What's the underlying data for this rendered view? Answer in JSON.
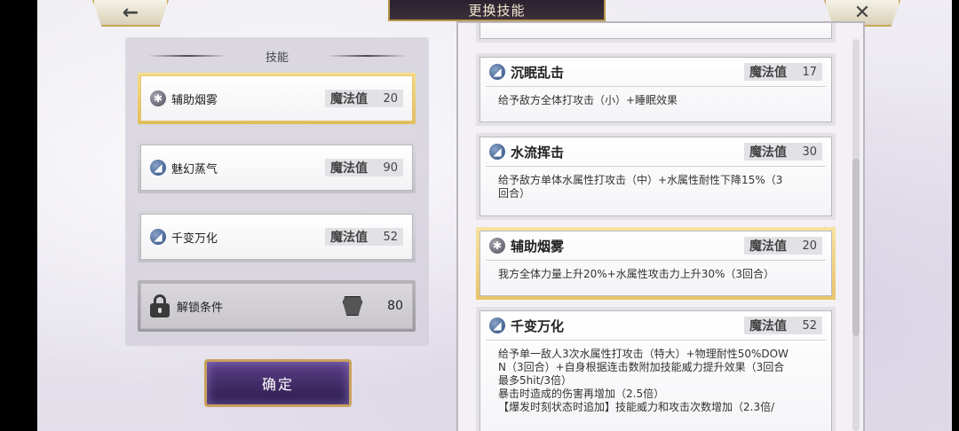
{
  "header": {
    "title": "更换技能",
    "back_icon": "←",
    "close_icon": "✕"
  },
  "left_panel": {
    "title": "技能",
    "slots": [
      {
        "name": "辅助烟雾",
        "mp_label": "魔法值",
        "mp": "20",
        "icon": "support-icon"
      },
      {
        "name": "魅幻蒸气",
        "mp_label": "魔法值",
        "mp": "90",
        "icon": "water-icon"
      },
      {
        "name": "千变万化",
        "mp_label": "魔法值",
        "mp": "52",
        "icon": "water-icon"
      }
    ],
    "locked": {
      "label": "解锁条件",
      "value": "80"
    },
    "confirm_label": "确定"
  },
  "right_panel": {
    "cards": [
      {
        "name": "沉眠乱击",
        "mp_label": "魔法值",
        "mp": "17",
        "desc": "给予敌方全体打攻击（小）+睡眠效果"
      },
      {
        "name": "水流挥击",
        "mp_label": "魔法值",
        "mp": "30",
        "desc": "给予敌方单体水属性打攻击（中）+水属性耐性下降15%（3\n回合）"
      },
      {
        "name": "辅助烟雾",
        "mp_label": "魔法值",
        "mp": "20",
        "desc": "我方全体力量上升20%+水属性攻击力上升30%（3回合）"
      },
      {
        "name": "千变万化",
        "mp_label": "魔法值",
        "mp": "52",
        "desc": "给予单一敌人3次水属性打攻击（特大）+物理耐性50%DOW\nN（3回合）+自身根据连击数附加技能威力提升效果（3回合\n最多5hit/3倍）\n暴击时造成的伤害再增加（2.5倍）\n【爆发时刻状态时追加】技能威力和攻击次数增加（2.3倍/"
      }
    ]
  }
}
